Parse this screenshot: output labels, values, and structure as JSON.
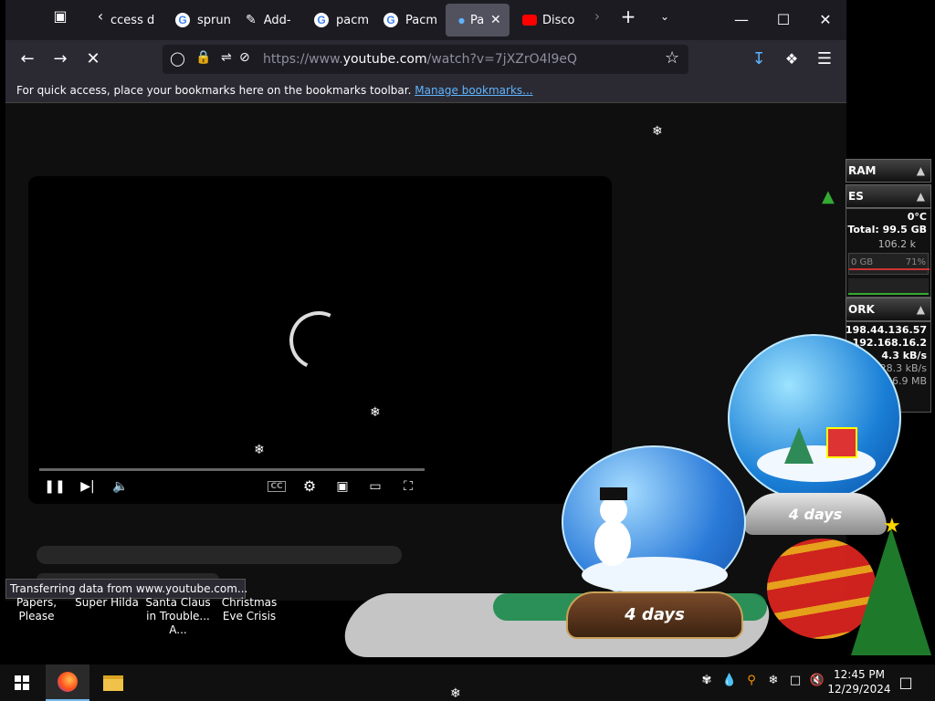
{
  "browser": {
    "tabs": [
      {
        "label": "ccess de"
      },
      {
        "label": "sprun"
      },
      {
        "label": "Add-"
      },
      {
        "label": "pacm"
      },
      {
        "label": "Pacm"
      },
      {
        "label": "Pa"
      },
      {
        "label": "Disco"
      }
    ],
    "url_prefix": "https://www.",
    "url_domain": "youtube.com",
    "url_path": "/watch?v=7jXZrO4l9eQ",
    "bookmarks_hint": "For quick access, place your bookmarks here on the bookmarks toolbar.",
    "bookmarks_link": "Manage bookmarks...",
    "status": "Transferring data from www.youtube.com..."
  },
  "desktop_icons": [
    {
      "label": "Papers, Please"
    },
    {
      "label": "Super Hilda"
    },
    {
      "label": "Santa Claus in Trouble... A..."
    },
    {
      "label": "Christmas Eve Crisis"
    }
  ],
  "gadget": {
    "ram_header": "RAM",
    "disk_header": "ES",
    "temp": "0°C",
    "total": "Total: 99.5 GB",
    "count": "106.2 k",
    "graph_left": "0 GB",
    "graph_right": "71%",
    "network_header": "ORK",
    "ip_external": "198.44.136.57",
    "ip_local": "192.168.16.2",
    "speed1": "4.3 kB/s",
    "speed2": "28.3 kB/s",
    "total_mb": "36.9 MB"
  },
  "snowglobe": {
    "label_left": "4 days",
    "label_right": "4 days"
  },
  "clock": {
    "time": "12:45 PM",
    "date": "12/29/2024"
  }
}
